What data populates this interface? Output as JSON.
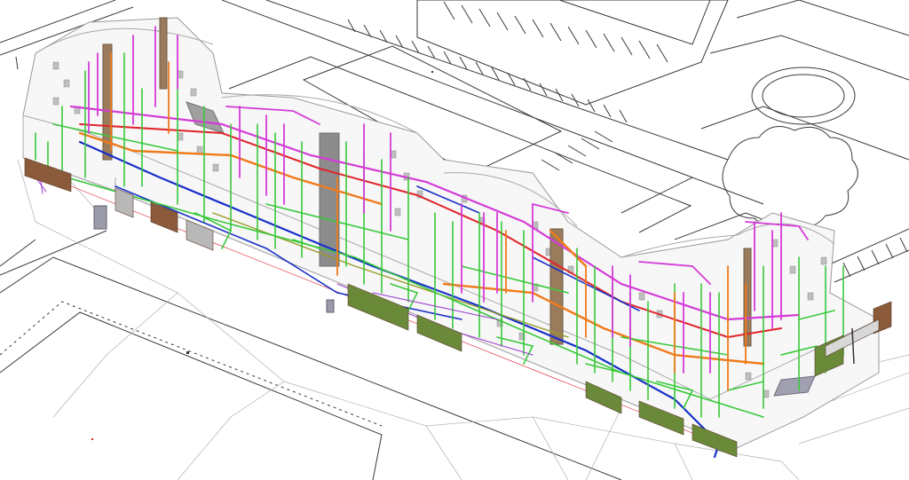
{
  "palette": {
    "background": "#ffffff",
    "site_lines": "#3a3a3a",
    "building_outline": "#9a9a9a",
    "wall_fill": "#f4f4f4",
    "pipe_green": "#39c93a",
    "pipe_magenta": "#d43bd8",
    "pipe_orange": "#f07a1a",
    "pipe_red": "#e0242a",
    "pipe_blue": "#1830c8",
    "pipe_olive": "#9a9a2a",
    "duct_grey": "#8c8c8c",
    "duct_brown": "#9a7b5c",
    "purple_lines": "#9a3ad0",
    "shopfront_brown": "#8a5a3a",
    "shopfront_green": "#6a8a3a"
  },
  "layers": [
    {
      "id": "site",
      "name": "site-plan-linework"
    },
    {
      "id": "building",
      "name": "building-massing"
    },
    {
      "id": "ducts",
      "name": "ductwork-risers"
    },
    {
      "id": "pipes",
      "name": "mep-pipework"
    },
    {
      "id": "shopfronts",
      "name": "retail-shopfronts"
    }
  ]
}
